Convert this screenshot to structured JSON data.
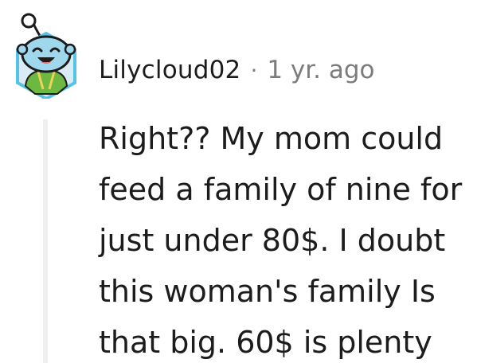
{
  "comment": {
    "username": "Lilycloud02",
    "separator": "·",
    "timestamp": "1 yr. ago",
    "body_lines": [
      "Right?? My mom could",
      "feed a family of nine for",
      "just under 80$. I doubt",
      "this woman's family Is",
      "that big. 60$ is plenty"
    ]
  },
  "avatar": {
    "icon": "snoo-avatar-icon",
    "colors": {
      "head": "#9fd8ec",
      "shirt": "#6db840",
      "frame": "#56c3e6"
    }
  }
}
